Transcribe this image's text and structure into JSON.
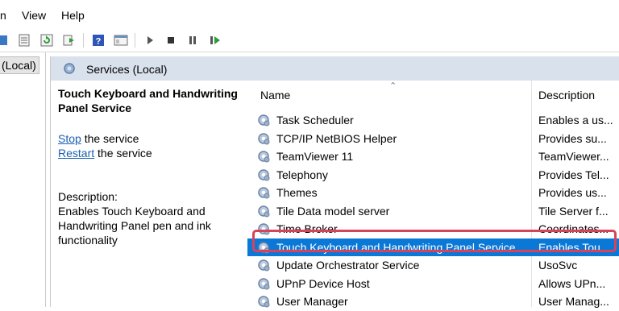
{
  "menu": {
    "items": [
      "n",
      "View",
      "Help"
    ]
  },
  "tree": {
    "node_label": "(Local)"
  },
  "panel": {
    "title": "Services (Local)"
  },
  "details": {
    "service_name": "Touch Keyboard and Handwriting Panel Service",
    "stop_link": "Stop",
    "stop_suffix": " the service",
    "restart_link": "Restart",
    "restart_suffix": " the service",
    "description_label": "Description:",
    "description_text": "Enables Touch Keyboard and Handwriting Panel pen and ink functionality"
  },
  "columns": {
    "name": "Name",
    "description": "Description"
  },
  "services": [
    {
      "name": "Task Scheduler",
      "description": "Enables a us..."
    },
    {
      "name": "TCP/IP NetBIOS Helper",
      "description": "Provides su..."
    },
    {
      "name": "TeamViewer 11",
      "description": "TeamViewer..."
    },
    {
      "name": "Telephony",
      "description": "Provides Tel..."
    },
    {
      "name": "Themes",
      "description": "Provides us..."
    },
    {
      "name": "Tile Data model server",
      "description": "Tile Server f..."
    },
    {
      "name": "Time Broker",
      "description": "Coordinates..."
    },
    {
      "name": "Touch Keyboard and Handwriting Panel Service",
      "description": "Enables Tou...",
      "selected": true
    },
    {
      "name": "Update Orchestrator Service",
      "description": "UsoSvc"
    },
    {
      "name": "UPnP Device Host",
      "description": "Allows UPn..."
    },
    {
      "name": "User Manager",
      "description": "User Manag..."
    }
  ],
  "colors": {
    "selection": "#0a78d7",
    "highlight_border": "#d9435a",
    "header_bg": "#d9e1ec",
    "link": "#1a5fb4"
  },
  "toolbar_icons": [
    "back-arrow-icon",
    "properties-icon",
    "refresh-icon",
    "export-list-icon",
    "help-icon",
    "console-view-icon",
    "start-service-icon",
    "stop-service-icon",
    "pause-service-icon",
    "restart-service-icon"
  ]
}
